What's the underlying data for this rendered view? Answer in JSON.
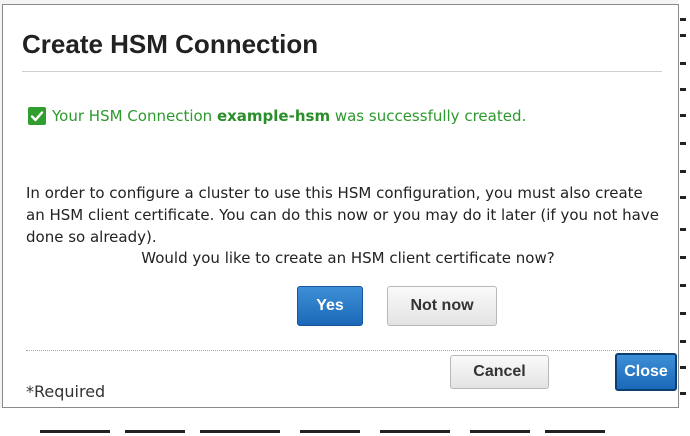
{
  "dialog": {
    "title": "Create HSM Connection",
    "success": {
      "prefix": "Your HSM Connection ",
      "name": "example-hsm",
      "suffix": " was successfully created."
    },
    "message": "In order to configure a cluster to use this HSM configuration, you must also create an HSM client certificate. You can do this now or you may do it later (if you not have done so already).",
    "question": "Would you like to create an HSM client certificate now?",
    "buttons": {
      "yes": "Yes",
      "not_now": "Not now",
      "cancel": "Cancel",
      "close": "Close"
    },
    "required_label": "*Required"
  },
  "colors": {
    "success_green": "#2c9a2c",
    "primary_blue": "#1f6cbf"
  },
  "icons": {
    "success": "checkmark-icon"
  }
}
